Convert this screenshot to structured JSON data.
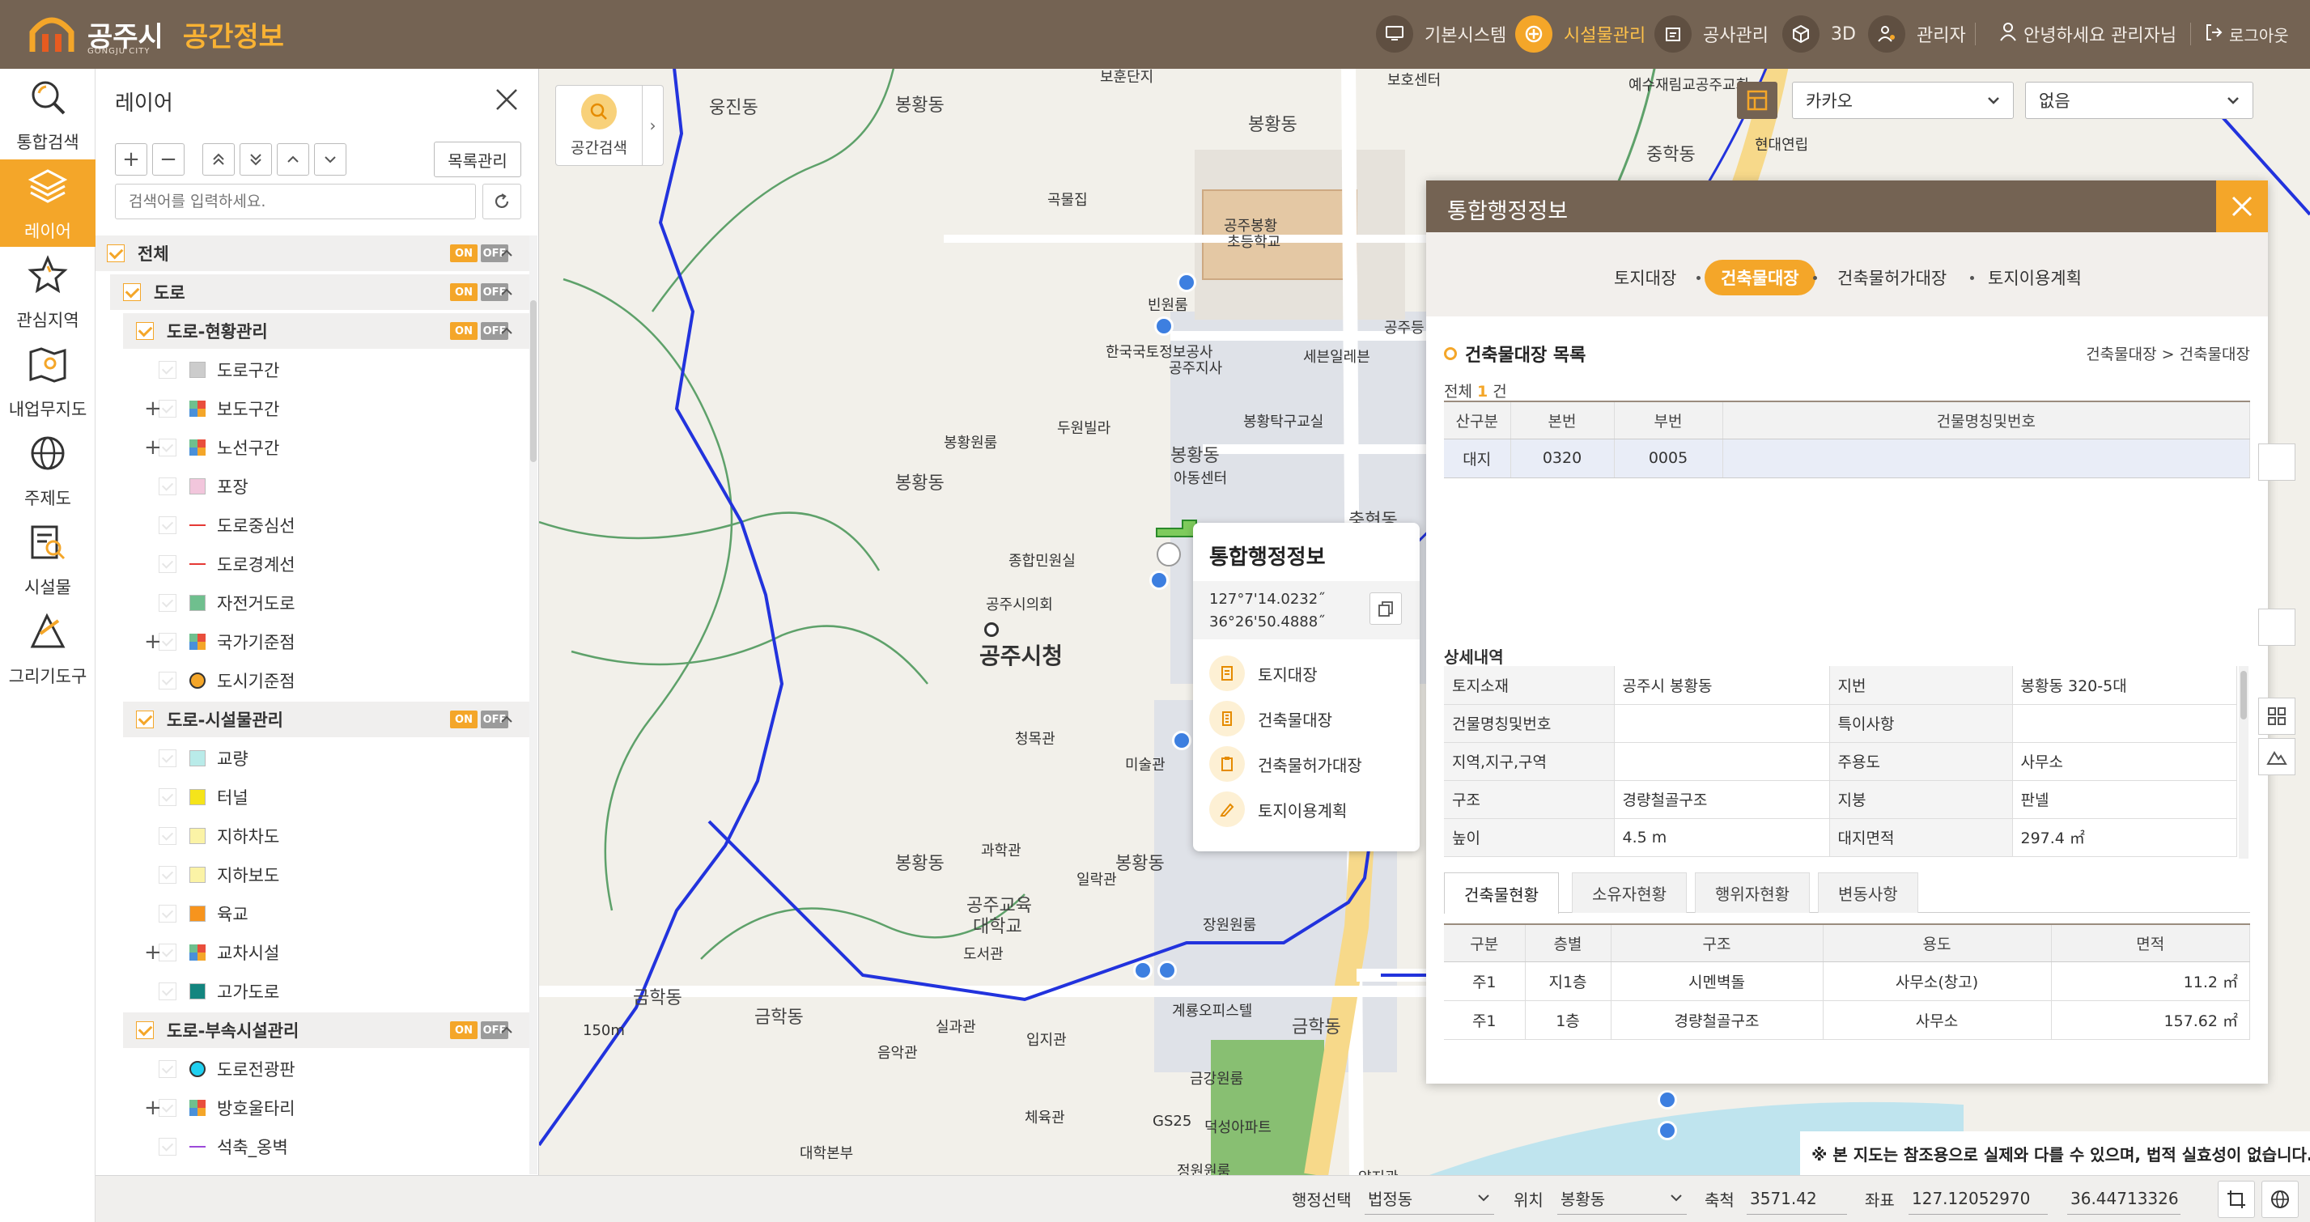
{
  "app": {
    "city": "공주시",
    "title": "공간정보",
    "sub": "GONGJU CITY"
  },
  "header": {
    "nav": [
      {
        "label": "기본시스템",
        "icon": "monitor-icon"
      },
      {
        "label": "시설물관리",
        "icon": "facility-icon",
        "active": true
      },
      {
        "label": "공사관리",
        "icon": "construction-icon"
      },
      {
        "label": "3D",
        "icon": "cube-icon"
      },
      {
        "label": "관리자",
        "icon": "admin-icon"
      }
    ],
    "greeting": "안녕하세요 관리자님",
    "logout": "로그아웃"
  },
  "leftbar": [
    {
      "label": "통합검색",
      "icon": "search-icon"
    },
    {
      "label": "레이어",
      "icon": "layers-icon",
      "active": true
    },
    {
      "label": "관심지역",
      "icon": "star-icon"
    },
    {
      "label": "내업무지도",
      "icon": "my-map-icon"
    },
    {
      "label": "주제도",
      "icon": "globe-icon"
    },
    {
      "label": "시설물",
      "icon": "facility-search-icon"
    },
    {
      "label": "그리기도구",
      "icon": "draw-tool-icon"
    }
  ],
  "layer_panel": {
    "title": "레이어",
    "list_manage": "목록관리",
    "search_placeholder": "검색어를 입력하세요.",
    "on": "ON",
    "off": "OFF",
    "tree": [
      {
        "label": "전체",
        "level": 0,
        "group": true,
        "checked": true
      },
      {
        "label": "도로",
        "level": 1,
        "group": true,
        "checked": true
      },
      {
        "label": "도로-현황관리",
        "level": 2,
        "group": true,
        "checked": true
      },
      {
        "label": "도로구간",
        "level": 3,
        "swatch": "#cccccc"
      },
      {
        "label": "보도구간",
        "level": 3,
        "swatch": "multi",
        "plus": true
      },
      {
        "label": "노선구간",
        "level": 3,
        "swatch": "multi",
        "plus": true
      },
      {
        "label": "포장",
        "level": 3,
        "swatch": "#f2c6dc"
      },
      {
        "label": "도로중심선",
        "level": 3,
        "swatch": "line-red"
      },
      {
        "label": "도로경계선",
        "level": 3,
        "swatch": "line-red"
      },
      {
        "label": "자전거도로",
        "level": 3,
        "swatch": "#6fbf8e"
      },
      {
        "label": "국가기준점",
        "level": 3,
        "swatch": "multi",
        "plus": true
      },
      {
        "label": "도시기준점",
        "level": 3,
        "swatch": "circle-orange"
      },
      {
        "label": "도로-시설물관리",
        "level": 2,
        "group": true,
        "checked": true
      },
      {
        "label": "교량",
        "level": 3,
        "swatch": "#b9ebe9"
      },
      {
        "label": "터널",
        "level": 3,
        "swatch": "#f5e41a"
      },
      {
        "label": "지하차도",
        "level": 3,
        "swatch": "#fbf3a6"
      },
      {
        "label": "지하보도",
        "level": 3,
        "swatch": "#fbf3a6"
      },
      {
        "label": "육교",
        "level": 3,
        "swatch": "#f7941d"
      },
      {
        "label": "교차시설",
        "level": 3,
        "swatch": "multi",
        "plus": true
      },
      {
        "label": "고가도로",
        "level": 3,
        "swatch": "#13857f"
      },
      {
        "label": "도로-부속시설관리",
        "level": 2,
        "group": true,
        "checked": true
      },
      {
        "label": "도로전광판",
        "level": 3,
        "swatch": "circle-cyan"
      },
      {
        "label": "방호울타리",
        "level": 3,
        "swatch": "multi",
        "plus": true
      },
      {
        "label": "석축_옹벽",
        "level": 3,
        "swatch": "line-purple"
      }
    ]
  },
  "map": {
    "spatial_search": "공간검색",
    "basemap": "카카오",
    "overlay": "없음",
    "labels": [
      "웅진동",
      "봉황동",
      "보훈단지",
      "봉황동",
      "보호센터",
      "예수재림교공주교회",
      "중학동",
      "현대연립",
      "곡물집",
      "공주봉황",
      "초등학교",
      "빈원룸",
      "한국국토정보공사",
      "공주지사",
      "세븐일레븐",
      "공주등",
      "봉황원룸",
      "두원빌라",
      "봉황탁구교실",
      "봉황동",
      "봉황동",
      "아동센터",
      "종합민원실",
      "공주시의회",
      "공주시청",
      "청목관",
      "미술관",
      "봉황동",
      "과학관",
      "일락관",
      "공주교육",
      "대학교",
      "봉황동",
      "장원원룸",
      "도서관",
      "금학동",
      "금학동",
      "실과관",
      "입지관",
      "계룡오피스텔",
      "금학동",
      "음악관",
      "금강원룸",
      "체육관",
      "덕성아파트",
      "대학본부",
      "정원원룸",
      "GS25",
      "충현동",
      "150m",
      "양지관"
    ]
  },
  "popup": {
    "title": "통합행정정보",
    "lon": "127°7'14.0232˝",
    "lat": "36°26'50.4888˝",
    "menu": [
      "토지대장",
      "건축물대장",
      "건축물허가대장",
      "토지이용계획"
    ]
  },
  "info_panel": {
    "title": "통합행정정보",
    "tabs": [
      "토지대장",
      "건축물대장",
      "건축물허가대장",
      "토지이용계획"
    ],
    "active_tab": "건축물대장",
    "list_title": "건축물대장 목록",
    "breadcrumb": "건축물대장 > 건축물대장",
    "count_prefix": "전체",
    "count": "1",
    "count_suffix": "건",
    "list_columns": [
      "산구분",
      "본번",
      "부번",
      "건물명칭및번호"
    ],
    "list_rows": [
      [
        "대지",
        "0320",
        "0005",
        ""
      ]
    ],
    "detail_title": "상세내역",
    "detail": [
      [
        "토지소재",
        "공주시 봉황동",
        "지번",
        "봉황동 320-5대"
      ],
      [
        "건물명칭및번호",
        "",
        "특이사항",
        ""
      ],
      [
        "지역,지구,구역",
        "",
        "주용도",
        "사무소"
      ],
      [
        "구조",
        "경량철골구조",
        "지붕",
        "판넬"
      ],
      [
        "높이",
        "4.5 m",
        "대지면적",
        "297.4 ㎡"
      ]
    ],
    "sub_tabs": [
      "건축물현황",
      "소유자현황",
      "행위자현황",
      "변동사항"
    ],
    "bld_columns": [
      "구분",
      "층별",
      "구조",
      "용도",
      "면적"
    ],
    "bld_rows": [
      [
        "주1",
        "지1층",
        "시멘벽돌",
        "사무소(창고)",
        "11.2 ㎡"
      ],
      [
        "주1",
        "1층",
        "경량철골구조",
        "사무소",
        "157.62 ㎡"
      ]
    ]
  },
  "disclaimer": "※ 본 지도는 참조용으로 실제와 다를 수 있으며, 법적 실효성이 없습니다.",
  "status": {
    "admin_label": "행정선택",
    "admin_value": "법정동",
    "loc_label": "위치",
    "loc_value": "봉황동",
    "scale_label": "축척",
    "scale_value": "3571.42",
    "coord_label": "좌표",
    "x": "127.12052970",
    "y": "36.44713326"
  },
  "colors": {
    "brand": "#746353",
    "accent": "#f4a629"
  }
}
